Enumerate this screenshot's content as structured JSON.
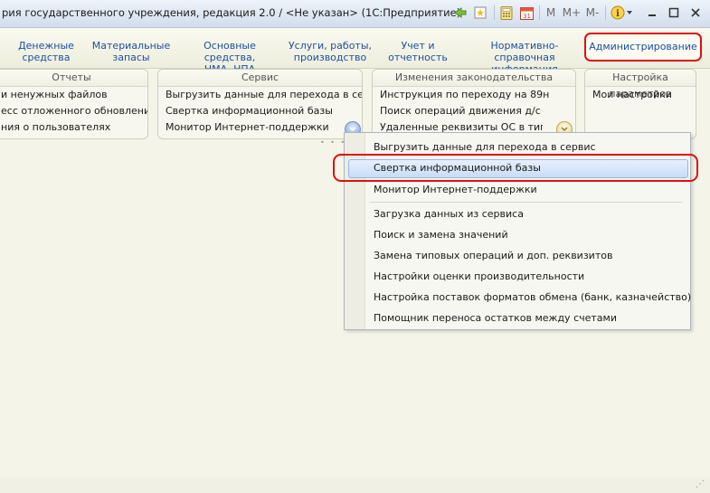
{
  "window": {
    "title": "рия государственного учреждения, редакция 2.0 / <Не указан>  (1С:Предприятие)",
    "toolbar": {
      "m_label": "M",
      "m_plus_label": "M+",
      "m_minus_label": "M-"
    }
  },
  "sections": [
    {
      "line1": "Денежные",
      "line2": "средства"
    },
    {
      "line1": "Материальные",
      "line2": "запасы"
    },
    {
      "line1": "Основные средства,",
      "line2": "НМА, НПА"
    },
    {
      "line1": "Услуги, работы,",
      "line2": "производство"
    },
    {
      "line1": "Учет и",
      "line2": "отчетность"
    },
    {
      "line1": "Нормативно-справочная",
      "line2": "информация"
    },
    {
      "line1": "Администрирование",
      "line2": ""
    }
  ],
  "panels": {
    "reports": {
      "header": "Отчеты",
      "items": [
        "и ненужных файлов",
        "есс отложенного обновления",
        "ния о пользователях"
      ]
    },
    "service": {
      "header": "Сервис",
      "items": [
        "Выгрузить данные для перехода в сер...",
        "Свертка информационной базы",
        "Монитор Интернет-поддержки"
      ]
    },
    "law_changes": {
      "header": "Изменения законодательства",
      "items": [
        "Инструкция по переходу на 89н",
        "Поиск операций движения д/с",
        "Удаленные реквизиты ОС  в типо..."
      ]
    },
    "settings": {
      "header": "Настройка параметров",
      "items": [
        "Мои настройки"
      ]
    }
  },
  "dropdown": {
    "group1": [
      "Выгрузить данные для перехода в сервис",
      "Свертка информационной базы",
      "Монитор Интернет-поддержки"
    ],
    "group2": [
      "Загрузка данных из сервиса",
      "Поиск и замена значений",
      "Замена типовых операций и доп. реквизитов",
      "Настройки оценки производительности",
      "Настройка поставок форматов обмена (банк, казначейство)",
      "Помощник переноса остатков между счетами"
    ],
    "highlighted_index": 1
  },
  "colors": {
    "link": "#1f4ea3",
    "annotation_red": "#e01010",
    "highlight": "#c9dcf6"
  },
  "icons": [
    "back-forward-icon",
    "favorites-star-icon",
    "calculator-icon",
    "calendar-icon",
    "info-icon",
    "minimize-icon",
    "maximize-icon",
    "close-icon"
  ]
}
